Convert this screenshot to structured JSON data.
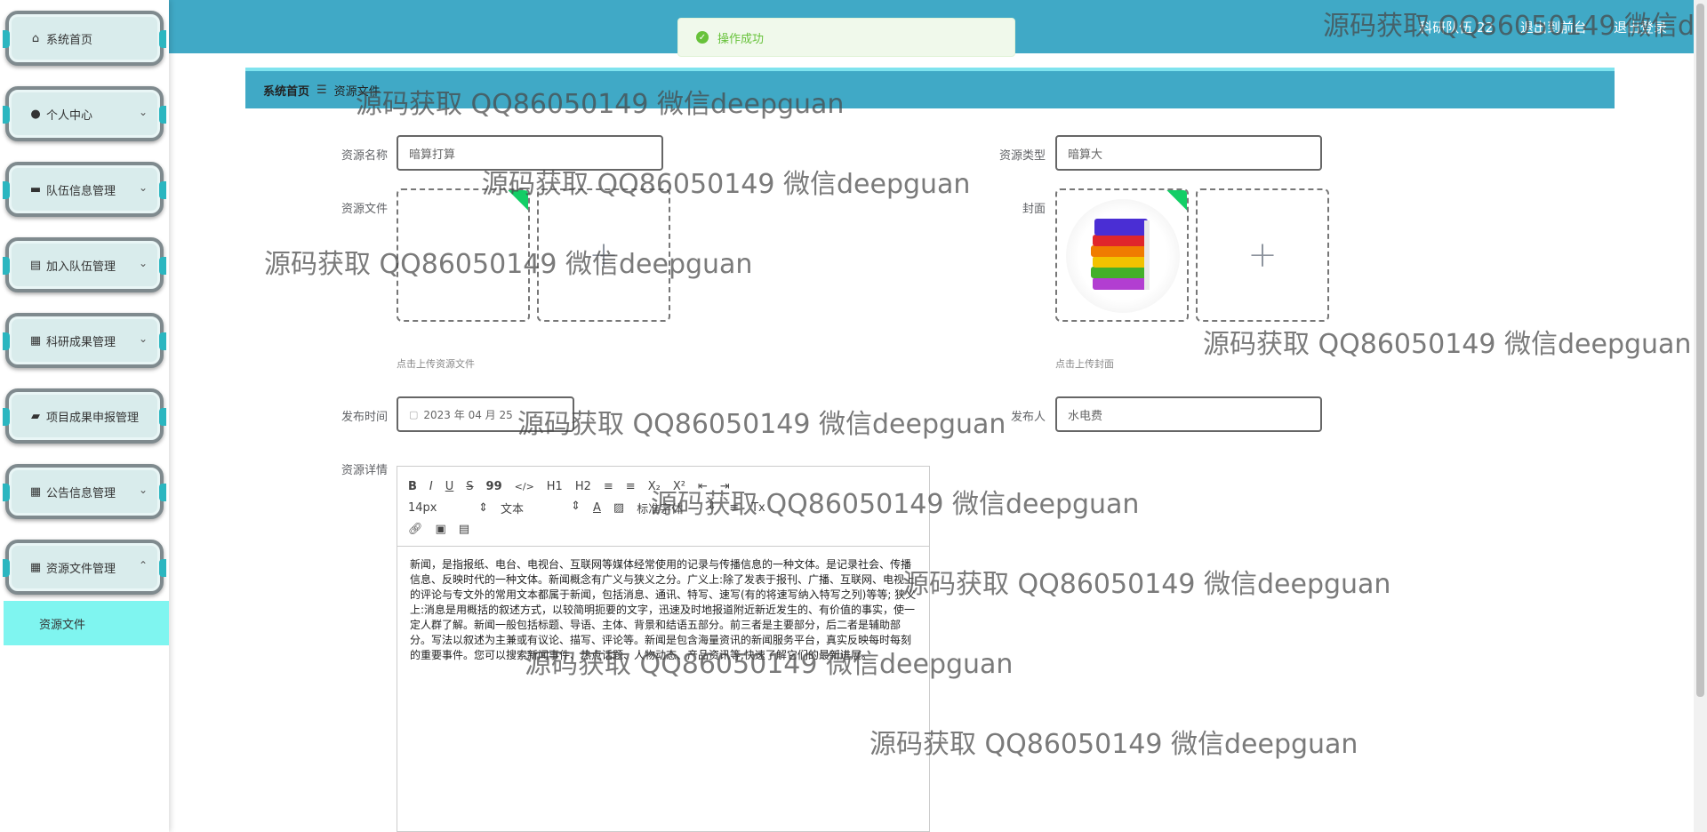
{
  "header": {
    "links": [
      "科研队伍 22",
      "退出到前台",
      "退出登录"
    ]
  },
  "sidebar": {
    "items": [
      {
        "label": "系统首页",
        "icon": "home-icon",
        "has_children": false
      },
      {
        "label": "个人中心",
        "icon": "user-icon",
        "has_children": true
      },
      {
        "label": "队伍信息管理",
        "icon": "monitor-icon",
        "has_children": true
      },
      {
        "label": "加入队伍管理",
        "icon": "clipboard-icon",
        "has_children": true
      },
      {
        "label": "科研成果管理",
        "icon": "grid-icon",
        "has_children": true
      },
      {
        "label": "项目成果申报管理",
        "icon": "briefcase-icon",
        "has_children": false
      },
      {
        "label": "公告信息管理",
        "icon": "grid-icon",
        "has_children": true
      },
      {
        "label": "资源文件管理",
        "icon": "grid-icon",
        "has_children": true,
        "expanded": true
      }
    ],
    "submenu_active": "资源文件"
  },
  "toast": {
    "message": "操作成功",
    "color": "#67c23a"
  },
  "breadcrumb": {
    "home": "系统首页",
    "current": "资源文件"
  },
  "form": {
    "name_label": "资源名称",
    "name_value": "暗算打算",
    "type_label": "资源类型",
    "type_value": "暗算大",
    "file_label": "资源文件",
    "file_hint": "点击上传资源文件",
    "cover_label": "封面",
    "cover_hint": "点击上传封面",
    "time_label": "发布时间",
    "time_value": "2023 年 04 月 25",
    "publisher_label": "发布人",
    "publisher_value": "水电费",
    "detail_label": "资源详情"
  },
  "editor": {
    "toolbar_row1": [
      "B",
      "I",
      "U",
      "S",
      "99",
      "</>",
      "H1",
      "H2",
      "≡",
      "≡",
      "X₂",
      "X²",
      "⇤",
      "⇥"
    ],
    "font_size": "14px",
    "block_format": "文本",
    "font_family": "标准字体",
    "content": "新闻，是指报纸、电台、电视台、互联网等媒体经常使用的记录与传播信息的一种文体。是记录社会、传播信息、反映时代的一种文体。新闻概念有广义与狭义之分。广义上:除了发表于报刊、广播、互联网、电视上的评论与专文外的常用文本都属于新闻，包括消息、通讯、特写、速写(有的将速写纳入特写之列)等等; 狭义上:消息是用概括的叙述方式，以较简明扼要的文字，迅速及时地报道附近新近发生的、有价值的事实，使一定人群了解。新闻一般包括标题、导语、主体、背景和结语五部分。前三者是主要部分，后二者是辅助部分。写法以叙述为主兼或有议论、描写、评论等。新闻是包含海量资讯的新闻服务平台，真实反映每时每刻的重要事件。您可以搜索新闻事件、热点话题、人物动态、产品资讯等,快速了解它们的最新进展。"
  },
  "watermark": "源码获取 QQ86050149 微信deepguan",
  "watermark_cut": "源码获取 QQ86050149 微信dee"
}
